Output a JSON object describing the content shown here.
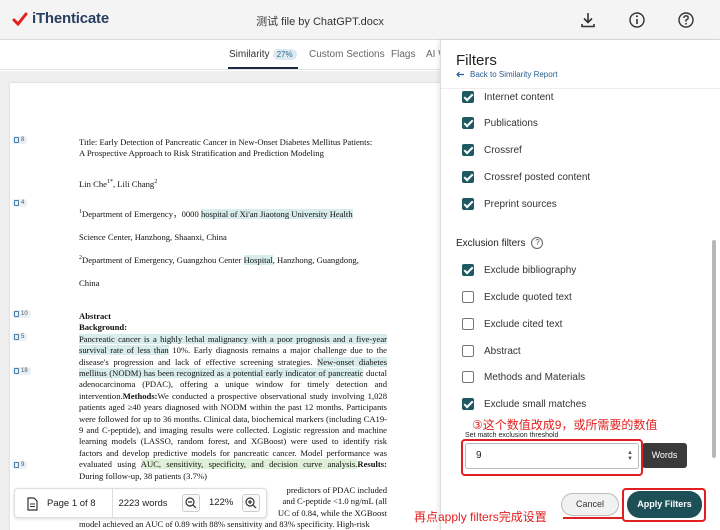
{
  "header": {
    "logo_text": "iThenticate",
    "doc_title": "测试 file by ChatGPT.docx",
    "icons": [
      "download-icon",
      "info-icon",
      "help-icon"
    ]
  },
  "tabs": [
    {
      "label": "Similarity",
      "badge": "27%"
    },
    {
      "label": "Custom Sections"
    },
    {
      "label": "Flags"
    },
    {
      "label": "AI W"
    }
  ],
  "document": {
    "markers": [
      "8",
      "4",
      "10",
      "5",
      "18",
      "9"
    ],
    "title_line1": "Title: Early Detection of Pancreatic Cancer in New-Onset Diabetes Mellitus Patients:",
    "title_line2": "A Prospective Approach to Risk Stratification and Prediction Modeling",
    "authors": "Lin Che",
    "authors_sup": "1*",
    "authors_2": ", Lili Chang",
    "authors_2_sup": "2",
    "aff1_a": "Department of Emergency，0000 ",
    "aff1_hl": "hospital of Xi'an Jiaotong University Health",
    "aff1_b": "Science Center, Hanzhong, Shaanxi, China",
    "aff2_a": "Department of Emergency, Guangzhou Center ",
    "aff2_hl": "Hospital",
    "aff2_b": ", Hanzhong, Guangdong,",
    "aff2_c": "China",
    "abstract_head": "Abstract",
    "background_head": "Background:",
    "abstract_p1_hl": "Pancreatic cancer is a highly lethal malignancy with a poor prognosis and a five-year survival rate of less than",
    "abstract_p1_b": " 10%. Early diagnosis remains a major challenge due to the disease's progression and lack of effective screening strategies.",
    "abstract_p2_hl": "New-onset diabetes mellitus (NODM) has been recognized as a potential early indicator of pancreatic",
    "abstract_p2_b": " ductal adenocarcinoma (PDAC), offering a unique window for timely detection and intervention.",
    "methods_head": "Methods:",
    "methods_text": "We conducted a prospective observational study involving 1,028 patients aged ≥40 years diagnosed with NODM within the past 12 months. Participants were followed for up to 36 months. Clinical data, biochemical markers (including CA19-9 and C-peptide), and imaging results were collected. Logistic regression and machine learning models (LASSO, random forest, and XGBoost) were used to identify risk factors and develop predictive models for pancreatic cancer. Model performance was evaluated using ",
    "methods_hl": "AUC, sensitivity, specificity, and decision curve analysis.",
    "results_head": "Results:",
    "results_text": " During follow-up, 38 patients (3.7%)",
    "results_tail1": "predictors of PDAC included",
    "results_tail2": "and C-peptide <1.0 ng/mL (all",
    "results_tail3": "UC of 0.84, while the XGBoost",
    "results_tail4": "model achieved an AUC of 0.89 with 88% sensitivity and 83% specificity. High-risk"
  },
  "toolbar": {
    "page_label": "Page 1 of 8",
    "words_label": "2223 words",
    "zoom_label": "122%"
  },
  "filters": {
    "title": "Filters",
    "back_label": "Back to Similarity Report",
    "sources": [
      {
        "label": "Internet content",
        "checked": true
      },
      {
        "label": "Publications",
        "checked": true
      },
      {
        "label": "Crossref",
        "checked": true
      },
      {
        "label": "Crossref posted content",
        "checked": true
      },
      {
        "label": "Preprint sources",
        "checked": true
      }
    ],
    "exclusion_title": "Exclusion filters",
    "exclusions": [
      {
        "label": "Exclude bibliography",
        "checked": true
      },
      {
        "label": "Exclude quoted text",
        "checked": false
      },
      {
        "label": "Exclude cited text",
        "checked": false
      },
      {
        "label": "Abstract",
        "checked": false
      },
      {
        "label": "Methods and Materials",
        "checked": false
      },
      {
        "label": "Exclude small matches",
        "checked": true
      }
    ],
    "threshold_label": "Set match exclusion threshold",
    "threshold_value": "9",
    "unit_button": "Words",
    "cancel_label": "Cancel",
    "apply_label": "Apply Filters"
  },
  "annotations": {
    "note_threshold": "③这个数值改成9，或所需要的数值",
    "note_apply": "再点apply filters完成设置",
    "color": "#e02020"
  }
}
